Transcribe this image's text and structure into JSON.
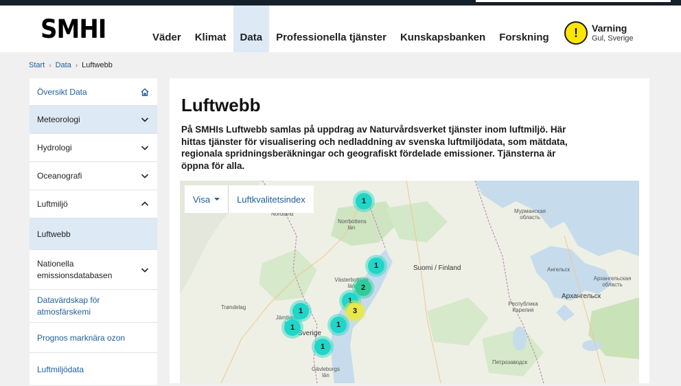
{
  "header": {
    "logo": "SMHI",
    "nav": [
      "Väder",
      "Klimat",
      "Data",
      "Professionella tjänster",
      "Kunskapsbanken",
      "Forskning"
    ],
    "active_nav": "Data",
    "warning": {
      "icon": "exclamation-icon",
      "title": "Varning",
      "subtitle": "Gul, Sverige",
      "color": "#ffe600"
    }
  },
  "breadcrumb": {
    "items": [
      "Start",
      "Data"
    ],
    "current": "Luftwebb"
  },
  "sidebar": {
    "items": [
      {
        "label": "Översikt Data",
        "icon": "home-icon"
      },
      {
        "label": "Meteorologi",
        "icon": "chevron-down-icon"
      },
      {
        "label": "Hydrologi",
        "icon": "chevron-down-icon"
      },
      {
        "label": "Oceanografi",
        "icon": "chevron-down-icon"
      },
      {
        "label": "Luftmiljö",
        "icon": "chevron-up-icon"
      },
      {
        "label": "Luftwebb"
      },
      {
        "label": "Nationella emissionsdatabasen",
        "icon": "chevron-down-icon"
      },
      {
        "label": "Datavärdskap för atmosfärskemi"
      },
      {
        "label": "Prognos marknära ozon"
      },
      {
        "label": "Luftmiljödata"
      }
    ]
  },
  "content": {
    "title": "Luftwebb",
    "intro": "På SMHIs Luftwebb samlas på uppdrag av Naturvårdsverket tjänster inom luftmiljö. Här hittas tjänster för visualisering och nedladdning av svenska luftmiljödata, som mätdata, regionala spridningsberäkningar och geografiskt fördelade emissioner. Tjänsterna är öppna för alla."
  },
  "map": {
    "controls": {
      "show": "Visa",
      "layer": "Luftkvalitetsindex"
    },
    "clusters": [
      "1",
      "1",
      "2",
      "1",
      "3",
      "1",
      "1",
      "1",
      "1"
    ],
    "labels": {
      "norrbotten": "Norrbottens län",
      "vasterbotten": "Västerbottens län",
      "jamtland": "Jämtlands län",
      "sverige": "Sverige",
      "gavleborg": "Gävleborgs län",
      "finland": "Suomi / Finland",
      "murmansk": "Мурманская область",
      "arkhangelsk": "Архангельск",
      "arkh_oblast": "Архангельская область",
      "karelia": "Республика Карелия",
      "petrozavodsk": "Петрозаводск",
      "nordland": "Nordland",
      "trondelag": "Trøndelag",
      "angelsk": "Ангельск"
    }
  }
}
